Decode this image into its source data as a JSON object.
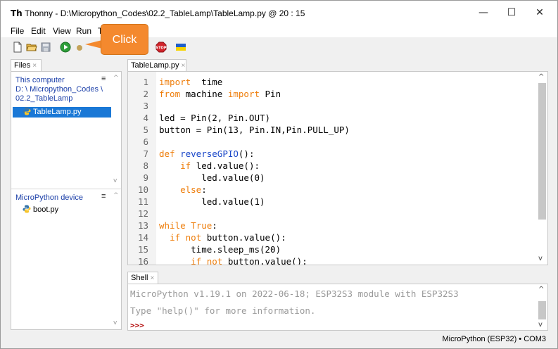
{
  "window": {
    "title": "Thonny  -  D:\\Micropython_Codes\\02.2_TableLamp\\TableLamp.py  @  20 : 15",
    "minimize": "—",
    "maximize": "☐",
    "close": "✕"
  },
  "menu": [
    "File",
    "Edit",
    "View",
    "Run",
    "T"
  ],
  "callout": {
    "label": "Click"
  },
  "files_tab": {
    "label": "Files",
    "close": "×"
  },
  "editor_tab": {
    "label": "TableLamp.py",
    "close": "×"
  },
  "shell_tab": {
    "label": "Shell",
    "close": "×"
  },
  "files": {
    "this_computer_label": "This computer",
    "path_line1": "D: \\ Micropython_Codes \\",
    "path_line2": "02.2_TableLamp",
    "local_files": [
      "TableLamp.py"
    ],
    "device_label": "MicroPython device",
    "device_files": [
      "boot.py"
    ],
    "menu_glyph": "≡"
  },
  "editor": {
    "line_numbers": [
      "1",
      "2",
      "3",
      "4",
      "5",
      "6",
      "7",
      "8",
      "9",
      "10",
      "11",
      "12",
      "13",
      "14",
      "15",
      "16"
    ]
  },
  "shell": {
    "line1": "MicroPython v1.19.1 on 2022-06-18; ESP32S3 module with ESP32S3",
    "line2": "Type \"help()\" for more information.",
    "prompt": ">>>"
  },
  "status": {
    "text": "MicroPython (ESP32)  •  COM3"
  },
  "colors": {
    "callout": "#f4892e",
    "keyword": "#ee7d0a",
    "function_name": "#1a47c9",
    "selection": "#1a78d6",
    "section_title": "#1a3ea8",
    "prompt": "#b00000"
  },
  "icons": [
    "new-file-icon",
    "open-file-icon",
    "save-icon",
    "run-icon",
    "stop-icon",
    "ukraine-flag-icon"
  ]
}
